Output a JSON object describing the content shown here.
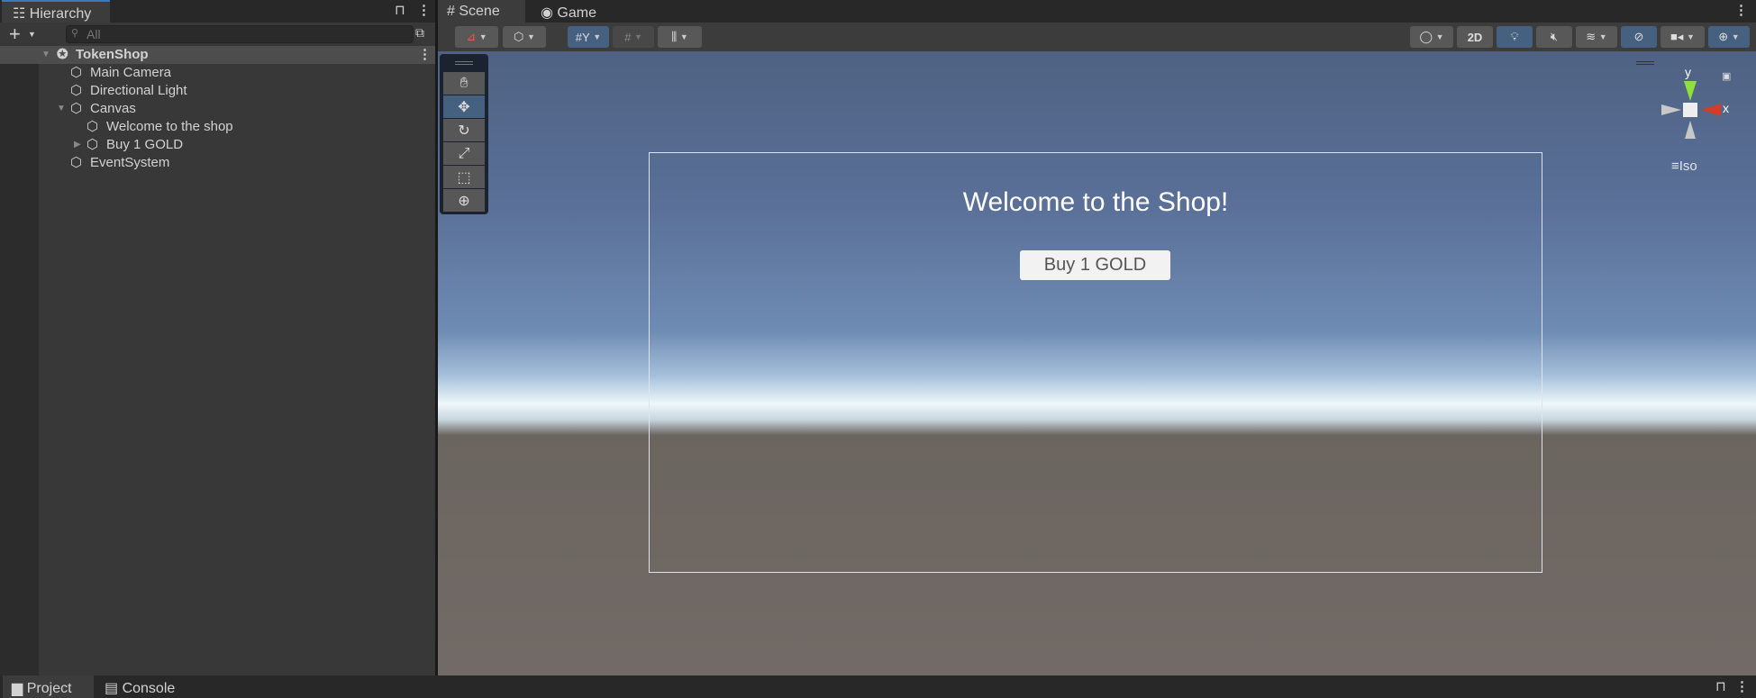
{
  "hierarchy": {
    "tab": "Hierarchy",
    "search_placeholder": "All",
    "scene": "TokenShop",
    "items": [
      "Main Camera",
      "Directional Light",
      "Canvas",
      "Welcome to the shop",
      "Buy 1 GOLD",
      "EventSystem"
    ]
  },
  "scene_view": {
    "tabs": [
      "Scene",
      "Game"
    ],
    "toggle_2d": "2D",
    "iso_label": "Iso",
    "axis_y": "y",
    "axis_x": "x"
  },
  "game_ui": {
    "title": "Welcome to the Shop!",
    "button": "Buy 1 GOLD"
  },
  "bottom": {
    "tabs": [
      "Project",
      "Console"
    ]
  }
}
